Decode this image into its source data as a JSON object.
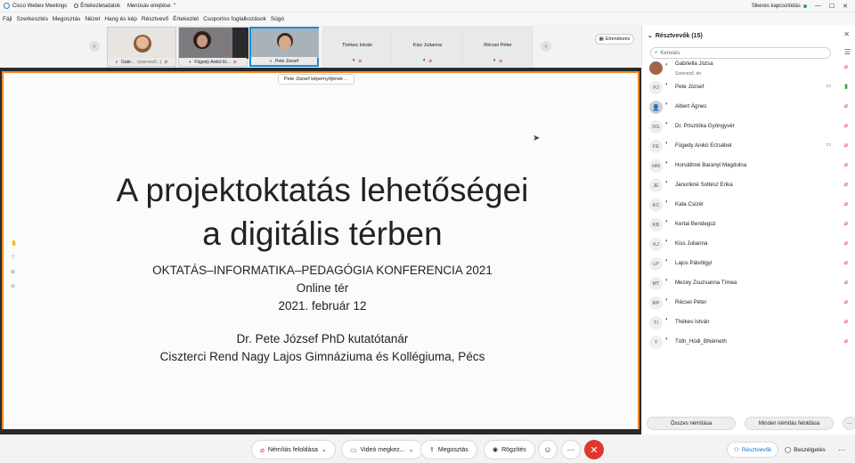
{
  "titlebar": {
    "app_name": "Cisco Webex Meetings",
    "meeting_info": "Értekezletadatok",
    "hide_menu": "Menüsáv elrejtése",
    "connection": "Sikeres kapcsolódás",
    "min": "—",
    "max": "☐",
    "close": "✕"
  },
  "menubar": [
    "Fájl",
    "Szerkesztés",
    "Megosztás",
    "Nézet",
    "Hang és kép",
    "Résztvevő",
    "Értekezlet",
    "Csoportos foglalkozások",
    "Súgó"
  ],
  "strip": {
    "prev": "‹",
    "next": "›",
    "tiles": [
      {
        "name": "Gabr...",
        "note": "(szervező...)",
        "kind": "photo"
      },
      {
        "name": "Fügedy Anikó Er...",
        "note": "",
        "kind": "photo"
      },
      {
        "name": "Pete József",
        "note": "",
        "kind": "photo"
      },
      {
        "name": "Thékes István",
        "note": "",
        "kind": "plain"
      },
      {
        "name": "Kiss Julianna",
        "note": "",
        "kind": "plain"
      },
      {
        "name": "Récsei Péter",
        "note": "",
        "kind": "plain"
      }
    ],
    "arrange_label": "Elrendezés"
  },
  "share": {
    "label": "Pete József képernyőjének ..."
  },
  "slide": {
    "title_line1": "A projektoktatás lehetőségei",
    "title_line2": "a digitális térben",
    "conference": "OKTATÁS–INFORMATIKA–PEDAGÓGIA KONFERENCIA 2021",
    "place": "Online tér",
    "date": "2021. február 12",
    "author": "Dr. Pete József PhD kutatótanár",
    "institution": "Ciszterci Rend Nagy Lajos Gimnáziuma és Kollégiuma, Pécs"
  },
  "bottombar": {
    "unmute": "Némítás feloldása",
    "video": "Videó megkez...",
    "share": "Megosztás",
    "record": "Rögzítés",
    "more": "···",
    "end": "✕",
    "participants": "Résztvevők",
    "chat": "Beszélgetés"
  },
  "panel": {
    "title": "Résztvevők (15)",
    "search_placeholder": "Keresés",
    "participants": [
      {
        "initials": "",
        "name": "Gabriella Józsa",
        "sub": "Szervező, én",
        "mic": "muted",
        "cam": false,
        "photo": true
      },
      {
        "initials": "PJ",
        "name": "Pete József",
        "sub": "",
        "mic": "on",
        "cam": true,
        "photo": false
      },
      {
        "initials": "",
        "name": "Albert Ágnes",
        "sub": "",
        "mic": "muted",
        "cam": false,
        "photo": false
      },
      {
        "initials": "DG",
        "name": "Dr. Prisztóka Gyöngyvér",
        "sub": "",
        "mic": "muted",
        "cam": false,
        "photo": false
      },
      {
        "initials": "FE",
        "name": "Fügedy Anikó Erzsébet",
        "sub": "",
        "mic": "muted",
        "cam": true,
        "photo": false
      },
      {
        "initials": "HM",
        "name": "Horváthné Baranyi Magdolna",
        "sub": "",
        "mic": "muted",
        "cam": false,
        "photo": false
      },
      {
        "initials": "JE",
        "name": "Janurikné Soltész Erika",
        "sub": "",
        "mic": "muted",
        "cam": false,
        "photo": false
      },
      {
        "initials": "KC",
        "name": "Kata Csizér",
        "sub": "",
        "mic": "muted",
        "cam": false,
        "photo": false
      },
      {
        "initials": "KB",
        "name": "Kertai Bendegúz",
        "sub": "",
        "mic": "muted",
        "cam": false,
        "photo": false
      },
      {
        "initials": "KJ",
        "name": "Kiss Julianna",
        "sub": "",
        "mic": "muted",
        "cam": false,
        "photo": false
      },
      {
        "initials": "LP",
        "name": "Lajos Pálvölgyi",
        "sub": "",
        "mic": "muted",
        "cam": false,
        "photo": false
      },
      {
        "initials": "MT",
        "name": "Mezey Zsuzsanna Tímea",
        "sub": "",
        "mic": "muted",
        "cam": false,
        "photo": false
      },
      {
        "initials": "RP",
        "name": "Récsei Péter",
        "sub": "",
        "mic": "muted",
        "cam": false,
        "photo": false
      },
      {
        "initials": "TI",
        "name": "Thékes István",
        "sub": "",
        "mic": "muted",
        "cam": false,
        "photo": false
      },
      {
        "initials": "T",
        "name": "Tóth_Hódi_BNémeth",
        "sub": "",
        "mic": "muted",
        "cam": false,
        "photo": false
      }
    ],
    "mute_all": "Összes némítása",
    "unmute_all": "Minden némítás feloldása",
    "more": "···"
  },
  "colors": {
    "accent": "#f08a2a",
    "end": "#e0362e",
    "muted": "#d23c3c",
    "on": "#2aa745",
    "link": "#1a6fc9"
  }
}
